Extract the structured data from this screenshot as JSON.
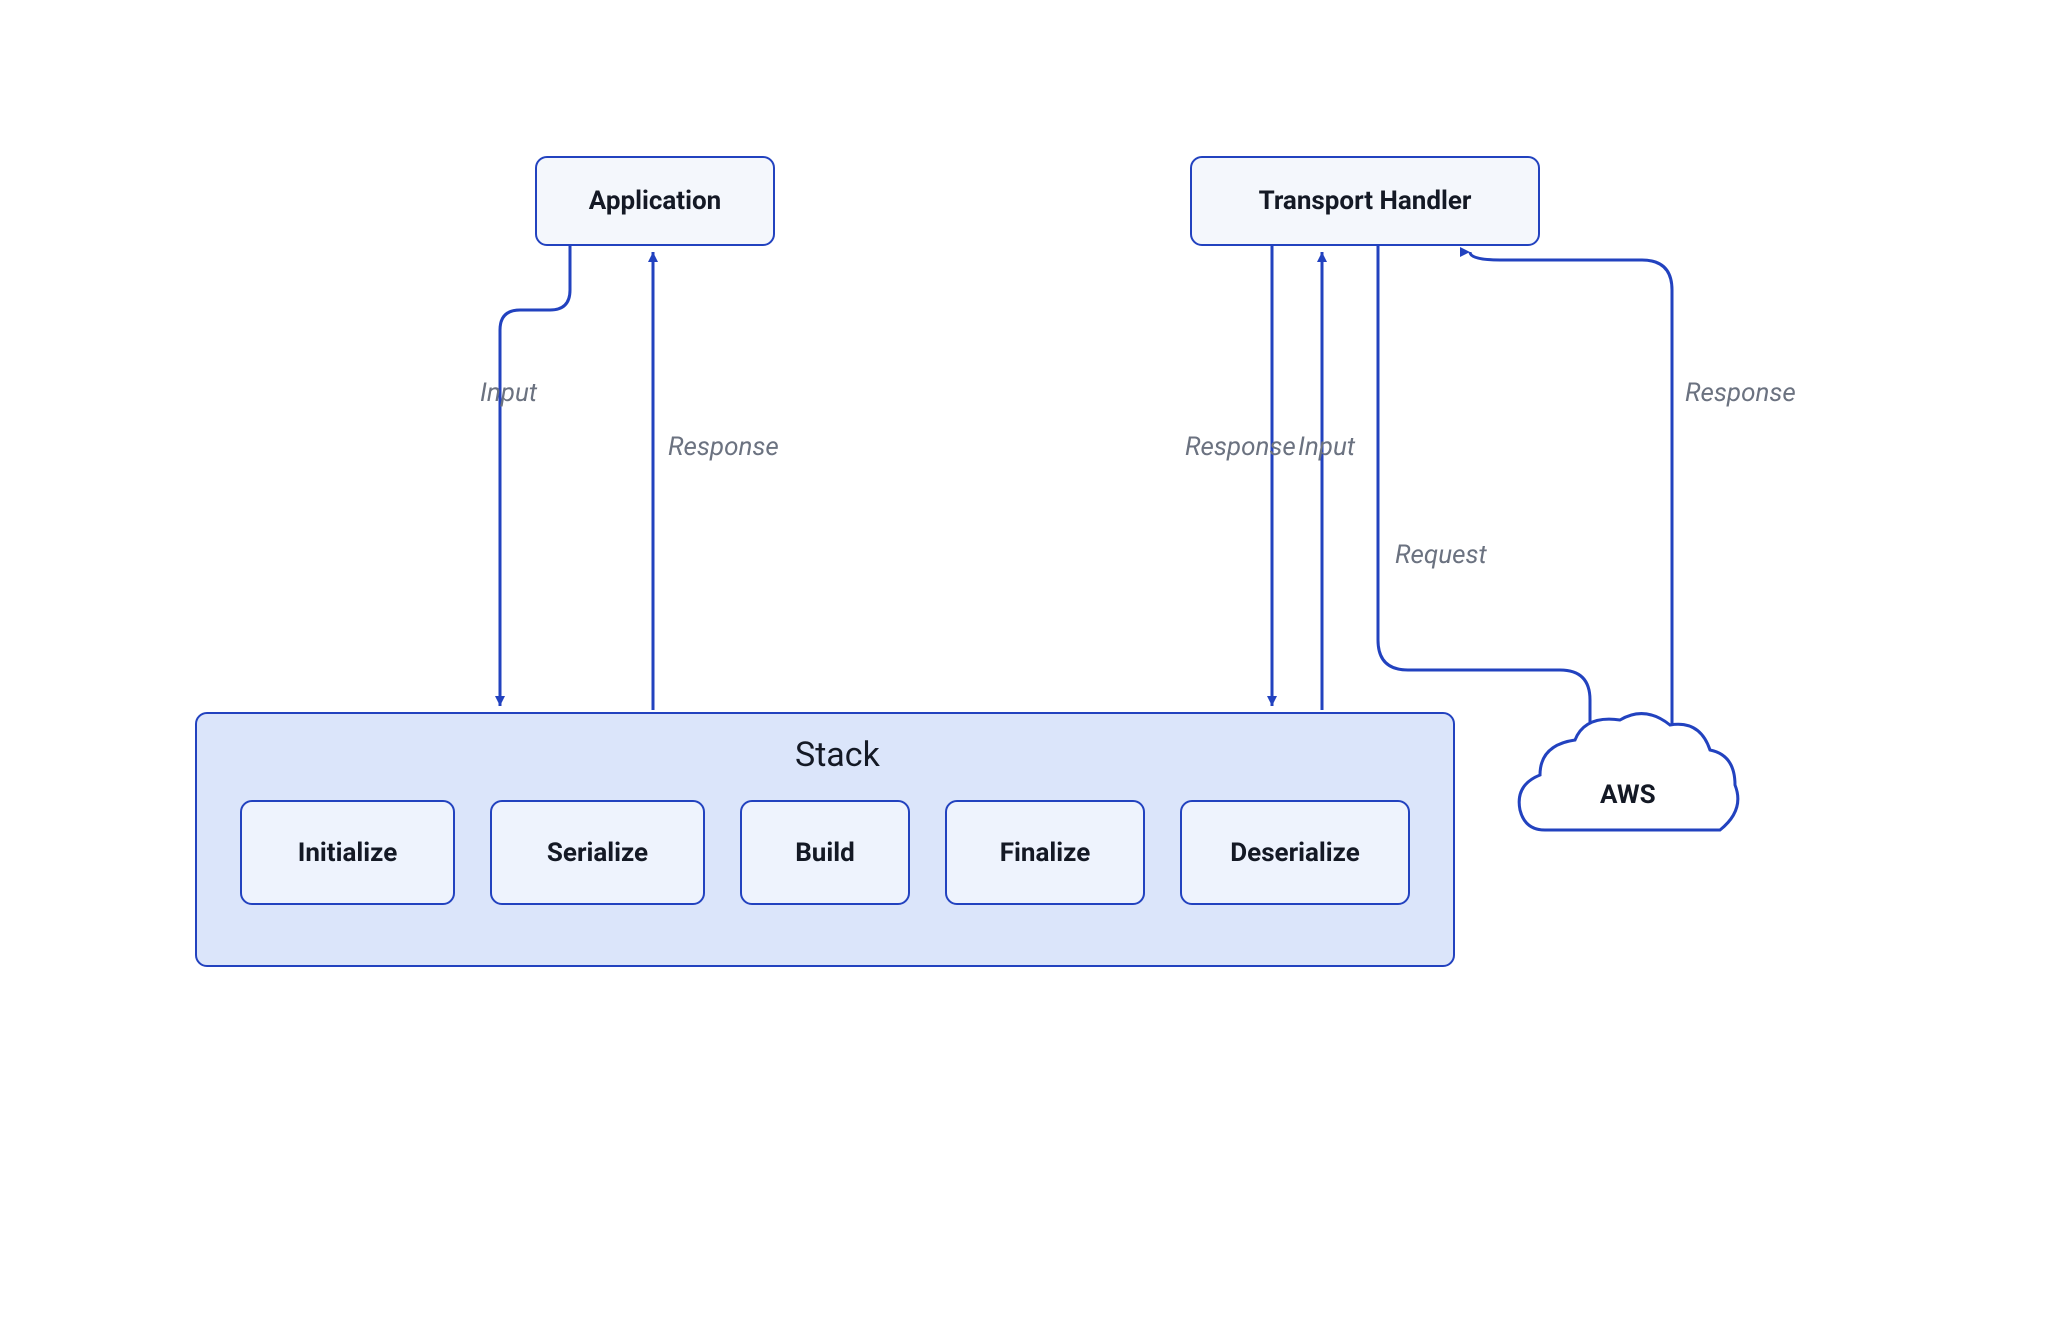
{
  "nodes": {
    "application": "Application",
    "transportHandler": "Transport Handler",
    "stack": "Stack",
    "aws": "AWS"
  },
  "steps": [
    "Initialize",
    "Serialize",
    "Build",
    "Finalize",
    "Deserialize"
  ],
  "flows": {
    "appInput": "Input",
    "appResponse": "Response",
    "thResponse": "Response",
    "thInput": "Input",
    "thRequest": "Request",
    "awsResponse": "Response"
  },
  "colors": {
    "border": "#2242bf",
    "lightFill": "#f4f7fc",
    "stackFill": "#dbe5fa",
    "stepFill": "#eef3fd",
    "labelGray": "#6b7280",
    "textDark": "#141925"
  }
}
